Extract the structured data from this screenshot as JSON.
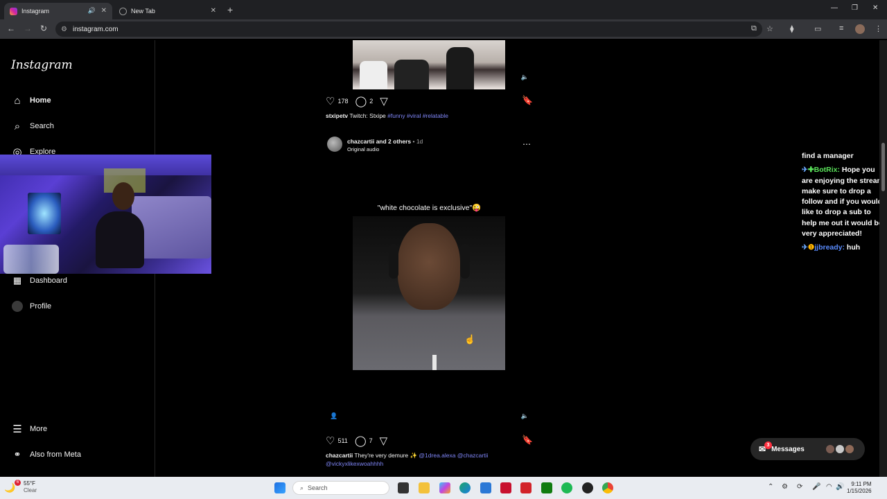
{
  "browser": {
    "tabs": [
      {
        "title": "Instagram",
        "active": true
      },
      {
        "title": "New Tab",
        "active": false
      }
    ],
    "url": "instagram.com"
  },
  "sidebar": {
    "logo": "Instagram",
    "items": [
      {
        "label": "Home",
        "icon": "home-icon"
      },
      {
        "label": "Search",
        "icon": "search-icon"
      },
      {
        "label": "Explore",
        "icon": "compass-icon"
      },
      {
        "label": "Dashboard",
        "icon": "dashboard-icon"
      },
      {
        "label": "Profile",
        "icon": "profile-avatar"
      },
      {
        "label": "More",
        "icon": "menu-icon"
      },
      {
        "label": "Also from Meta",
        "icon": "meta-icon"
      }
    ]
  },
  "posts": [
    {
      "likes": "178",
      "comments": "2",
      "caption_user": "stxipetv",
      "caption_text": " Twitch: Stxipe ",
      "caption_tags": "#funny #viral #relatable"
    },
    {
      "author": "chazcartii",
      "author_suffix": " and 2 others",
      "time": " • 1d",
      "audio": "Original audio",
      "overlay_text": "\"white chocolate is exclusive\"😜",
      "likes": "511",
      "comments": "7",
      "caption_user": "chazcartii",
      "caption_text": " They're very demure ✨ ",
      "caption_tags_line1": "@1drea.alexa @chazcartii",
      "caption_tags_line2": "@vickyxlikexwoahhhh"
    }
  ],
  "chat": {
    "line1": "find a manager",
    "bot_name": "BotRix:",
    "bot_message": " Hope you are enjoying the stream make sure to drop a follow and if you would like to drop a sub to help me out it would be very appreciated!",
    "user_name": "jjbready:",
    "user_message": " huh"
  },
  "messages": {
    "label": "Messages",
    "badge": "3"
  },
  "taskbar": {
    "temp": "55°F",
    "weather": "Clear",
    "search_placeholder": "Search",
    "time": "9:11 PM",
    "date": "1/15/2026",
    "weather_badge": "6"
  },
  "colors": {
    "accent_link": "#7f86f7",
    "bot_green": "#5be45b",
    "user_blue": "#5a8cff"
  }
}
